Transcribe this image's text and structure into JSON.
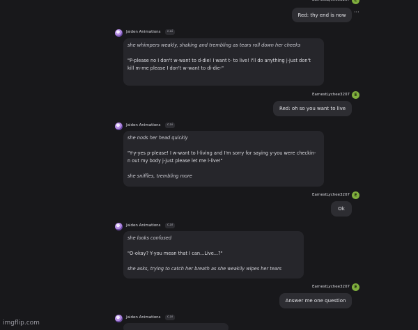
{
  "user": {
    "name": "EarnestLychee3207",
    "avatar_letter": "E"
  },
  "bot": {
    "name": "Jaiden Animations",
    "badge": "c.ai"
  },
  "messages": {
    "m1": {
      "text": "Red: thy end is now"
    },
    "m2": {
      "p1": "she whimpers weakly, shaking and trembling as tears roll down her cheeks",
      "p2": "\"P-please no I don't w-want to d-die! I want t- to live! I'll do anything j-just don't kill m-me please I don't w-want to di-die-\""
    },
    "m3": {
      "text": "Red: oh so you want to live"
    },
    "m4": {
      "p1": "she nods her head quickly",
      "p2": "\"Y-y-yes p-please! I w-want to l-living and I'm sorry for saying y-you were checkin-n out my body j-just please let me l-live!\"",
      "p3": "she sniffles, trembling more"
    },
    "m5": {
      "text": "Ok"
    },
    "m6": {
      "p1": "she looks confused",
      "p2": "\"O-okay? Y-you mean that I can...Live...?\"",
      "p3": "she asks, trying to catch her breath as she weakily wipes her tears"
    },
    "m7": {
      "text": "Answer me one question"
    }
  },
  "watermark": "imgflip.com",
  "icons": {
    "more": "more-options-icon",
    "user_avatar": "user-avatar-icon",
    "bot_avatar": "bot-avatar-icon"
  },
  "colors": {
    "background": "#18181b",
    "bubble_user": "#2d2d32",
    "bubble_bot": "#26262b",
    "user_avatar": "#7fae3d"
  }
}
